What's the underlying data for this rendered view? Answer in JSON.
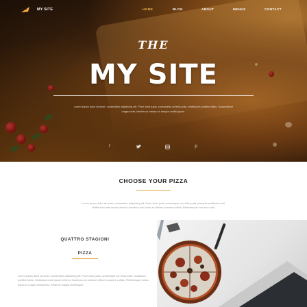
{
  "brand": {
    "name": "MY SITE",
    "logo_icon": "pizza-slice-icon"
  },
  "nav": {
    "items": [
      {
        "label": "HOME",
        "active": true
      },
      {
        "label": "BLOG",
        "active": false
      },
      {
        "label": "ABOUT",
        "active": false
      },
      {
        "label": "MENUS",
        "active": false
      },
      {
        "label": "CONTACT",
        "active": false
      }
    ]
  },
  "hero": {
    "pretitle": "THE",
    "title": "MY SITE",
    "description": "Lorem ipsum dolor sit amet, consectetur adipiscing elit. Proin dolor justo, consectetur at felis porta, vestibulum porttitor tellus. Suspendisse magna erat, lobortis ac massa et, tempus mollis ipsum.",
    "socials": [
      "facebook-icon",
      "twitter-icon",
      "instagram-icon",
      "pinterest-icon"
    ]
  },
  "section": {
    "title": "CHOOSE YOUR PIZZA",
    "description": "Lorem ipsum dolor sit amet, consectetur adipiscing elit. Proin dolor justo, scelerisque non felis porta, placerat vestibulum nisi. Vestibulum ante ipsum primis in faucibus orci luctus et ultrices posuere cubilia. Pellentesque non arcu odio."
  },
  "pizza": {
    "name": "QUATTRO STAGIONI",
    "category": "PIZZA",
    "description": "Lorem ipsum dolor sit amet, consectetur adipiscing elit. Proin dolor justo, scelerisque non felis porta, vestibulum porttitor tellus. Vestibulum ante ipsum primis in faucibus orci luctus et ultrices posuere cubilia. Pellentesque varius ipsum ut augue consectetur. Etiam et magna scelerisque."
  },
  "colors": {
    "accent": "#e3a33f",
    "heading": "#222222",
    "body_text": "#9a9a9a"
  }
}
